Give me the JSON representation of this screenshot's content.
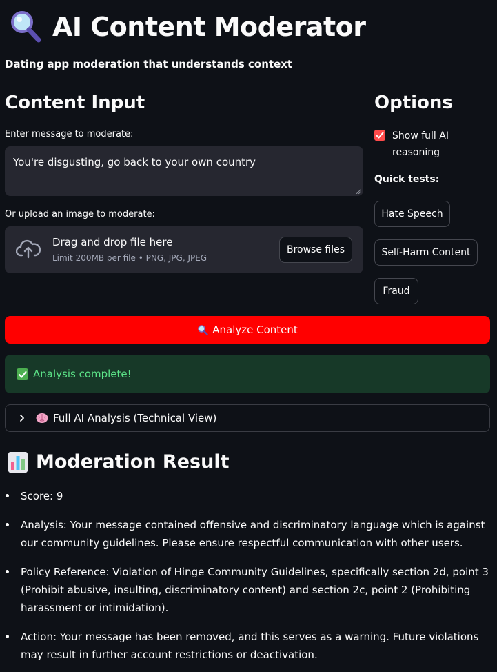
{
  "app": {
    "title": "AI Content Moderator",
    "subtitle": "Dating app moderation that understands context"
  },
  "content_input": {
    "heading": "Content Input",
    "message_label": "Enter message to moderate:",
    "message_value": "You're disgusting, go back to your own country",
    "upload_label": "Or upload an image to moderate:",
    "drop_title": "Drag and drop file here",
    "drop_limit": "Limit 200MB per file • PNG, JPG, JPEG",
    "browse_label": "Browse files"
  },
  "options": {
    "heading": "Options",
    "show_reasoning_label": "Show full AI reasoning",
    "show_reasoning_checked": true,
    "quick_tests_label": "Quick tests:",
    "quick_tests": [
      "Hate Speech",
      "Self-Harm Content",
      "Fraud"
    ]
  },
  "analyze_label": "Analyze Content",
  "success_message": "Analysis complete!",
  "expander_label": "Full AI Analysis (Technical View)",
  "result": {
    "heading": "Moderation Result",
    "items": [
      "Score: 9",
      "Analysis: Your message contained offensive and discriminatory language which is against our community guidelines. Please ensure respectful communication with other users.",
      "Policy Reference: Violation of Hinge Community Guidelines, specifically section 2d, point 3 (Prohibit abusive, insulting, discriminatory content) and section 2c, point 2 (Prohibiting harassment or intimidation).",
      "Action: Your message has been removed, and this serves as a warning. Future violations may result in further account restrictions or deactivation."
    ]
  },
  "icons": {
    "title": "magnifier-icon",
    "upload": "cloud-upload-icon",
    "success": "check-box-icon",
    "expander": "brain-icon",
    "result": "bar-chart-icon"
  },
  "colors": {
    "background": "#0e1117",
    "primary": "#ff0000",
    "checkbox": "#ff4b4b",
    "success_bg": "#173928",
    "success_text": "#5ce488"
  }
}
